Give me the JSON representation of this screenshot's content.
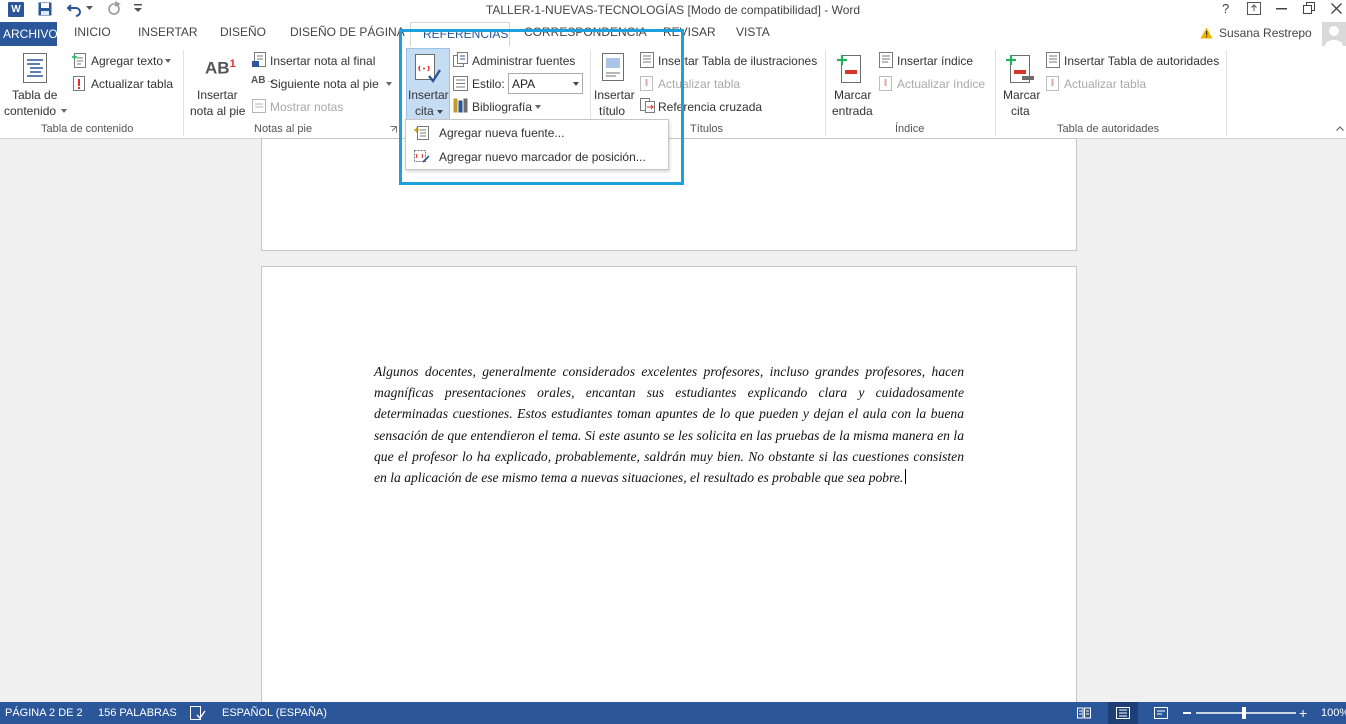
{
  "window": {
    "title": "TALLER-1-NUEVAS-TECNOLOGÍAS [Modo de compatibilidad] - Word",
    "user": "Susana Restrepo",
    "help": "?"
  },
  "tabs": [
    {
      "label": "ARCHIVO"
    },
    {
      "label": "INICIO"
    },
    {
      "label": "INSERTAR"
    },
    {
      "label": "DISEÑO"
    },
    {
      "label": "DISEÑO DE PÁGINA"
    },
    {
      "label": "REFERENCIAS"
    },
    {
      "label": "CORRESPONDENCIA"
    },
    {
      "label": "REVISAR"
    },
    {
      "label": "VISTA"
    }
  ],
  "ribbon": {
    "toc": {
      "big_label_1": "Tabla de",
      "big_label_2": "contenido",
      "add_text": "Agregar texto",
      "update_table": "Actualizar tabla",
      "group": "Tabla de contenido"
    },
    "footnotes": {
      "insert_1": "Insertar",
      "insert_2": "nota al pie",
      "endnote": "Insertar nota al final",
      "next_note": "Siguiente nota al pie",
      "show_notes": "Mostrar notas",
      "group": "Notas al pie",
      "ab_glyph": "AB",
      "sup_glyph": "1"
    },
    "citations": {
      "insert_1": "Insertar",
      "insert_2": "cita",
      "manage": "Administrar fuentes",
      "style_label": "Estilo:",
      "style_value": "APA",
      "bibliography": "Bibliografía"
    },
    "captions": {
      "insert_1": "Insertar",
      "insert_2": "título",
      "table_of_figures": "Insertar Tabla de ilustraciones",
      "update_table": "Actualizar tabla",
      "cross_ref": "Referencia cruzada",
      "group": "Títulos"
    },
    "index": {
      "mark_1": "Marcar",
      "mark_2": "entrada",
      "insert_index": "Insertar índice",
      "update_index": "Actualizar índice",
      "group": "Índice"
    },
    "authorities": {
      "mark_1": "Marcar",
      "mark_2": "cita",
      "insert_table": "Insertar Tabla de autoridades",
      "update_table": "Actualizar tabla",
      "group": "Tabla de autoridades"
    }
  },
  "dropdown": {
    "items": [
      {
        "label": "Agregar nueva fuente..."
      },
      {
        "label": "Agregar nuevo marcador de posición..."
      }
    ]
  },
  "document": {
    "paragraph": "Algunos docentes, generalmente considerados excelentes profesores, incluso grandes profesores, hacen magníficas presentaciones orales, encantan sus estudiantes explicando clara y cuidadosamente determinadas cuestiones. Estos estudiantes toman apuntes de lo que pueden y dejan el aula con la buena sensación de que entendieron el tema. Si este asunto se les solicita en las pruebas de la misma manera en la que el profesor lo ha explicado, probablemente, saldrán muy bien. No obstante si las cuestiones consisten en la aplicación de ese mismo tema a nuevas situaciones, el resultado es probable que sea pobre."
  },
  "status": {
    "page": "PÁGINA 2 DE 2",
    "words": "156 PALABRAS",
    "language": "ESPAÑOL (ESPAÑA)",
    "zoom": "100%"
  },
  "colors": {
    "accent": "#2b579a",
    "highlight": "#1ea0dc"
  }
}
